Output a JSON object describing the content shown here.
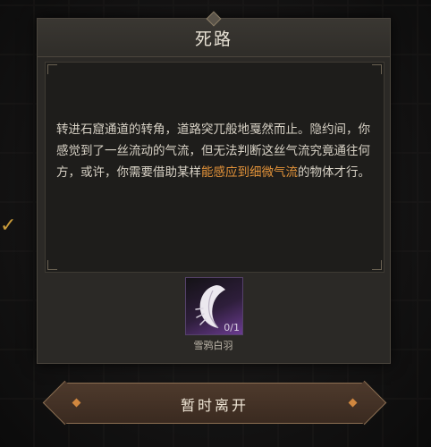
{
  "dialog": {
    "title": "死路",
    "story": {
      "part1": "转进石窟通道的转角，道路突兀般地戛然而止。隐约间，你感觉到了一丝流动的气流，但无法判断这丝气流究竟通往何方，或许，你需要借助某样",
      "highlight": "能感应到细微气流",
      "part2": "的物体才行。"
    },
    "highlight_color": "#e5943a",
    "required_item": {
      "name": "雪鸦白羽",
      "count": "0/1",
      "icon": "white-feather-icon"
    },
    "leave_button_label": "暂时离开"
  },
  "side_indicator_icon": "checkmark-icon",
  "accent_color": "#c99b3a"
}
